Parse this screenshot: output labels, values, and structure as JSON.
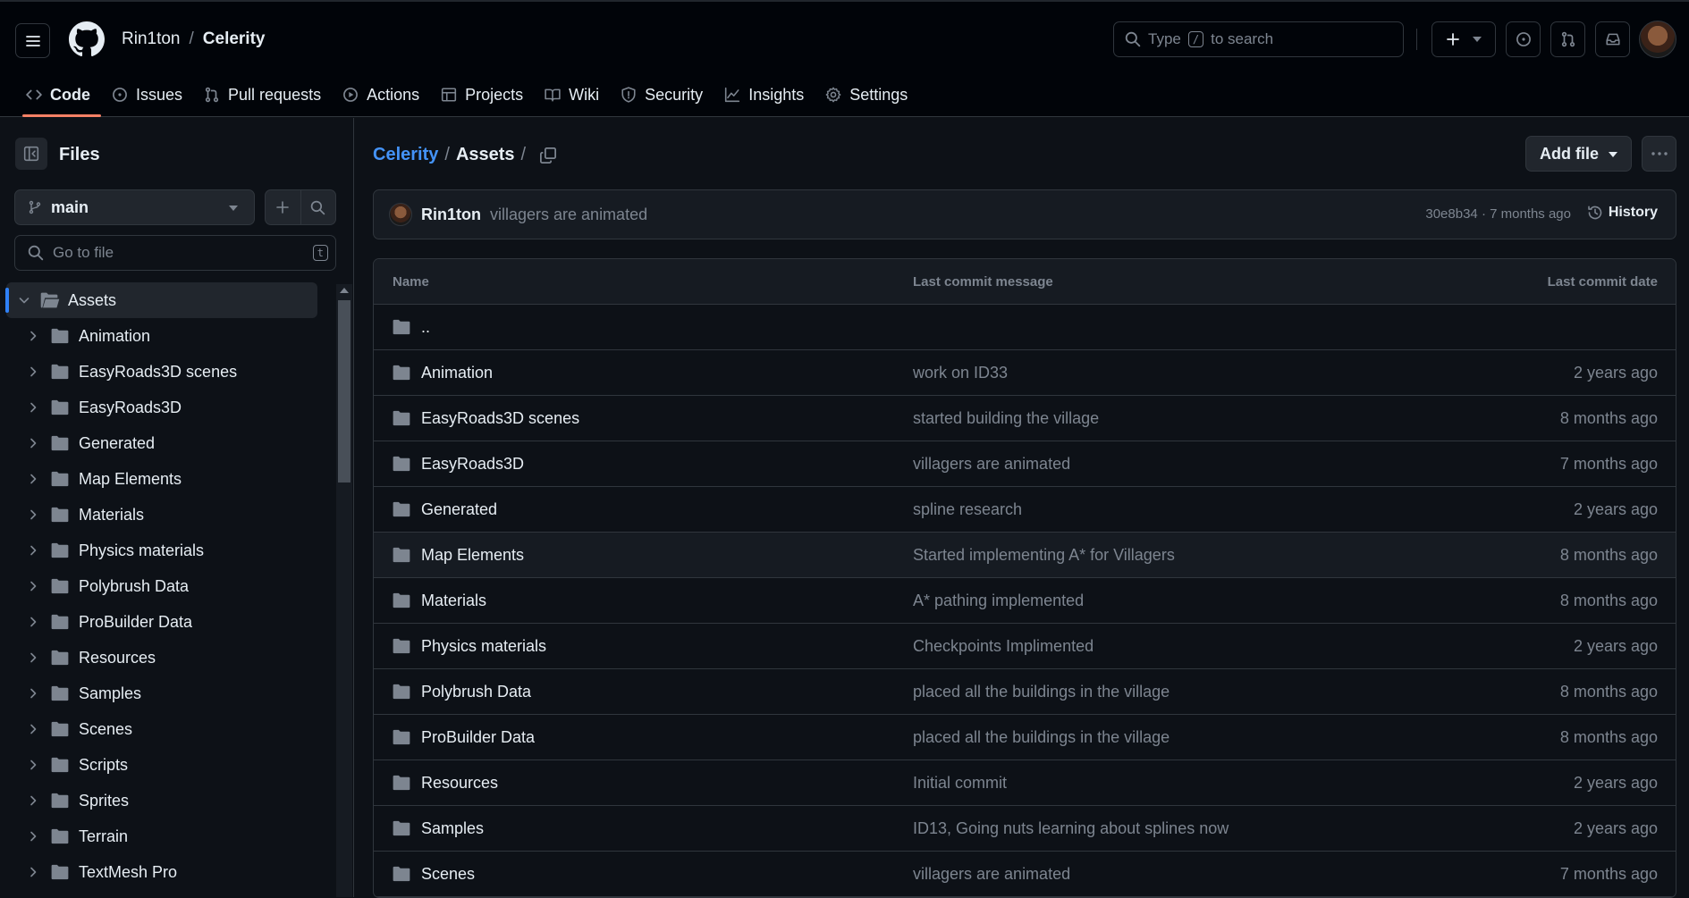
{
  "header": {
    "owner": "Rin1ton",
    "separator": "/",
    "repo": "Celerity",
    "search_prefix": "Type",
    "search_key": "/",
    "search_suffix": "to search"
  },
  "tabs": [
    {
      "label": "Code",
      "icon": "code-icon"
    },
    {
      "label": "Issues",
      "icon": "issue-icon"
    },
    {
      "label": "Pull requests",
      "icon": "pull-request-icon"
    },
    {
      "label": "Actions",
      "icon": "play-icon"
    },
    {
      "label": "Projects",
      "icon": "table-icon"
    },
    {
      "label": "Wiki",
      "icon": "book-icon"
    },
    {
      "label": "Security",
      "icon": "shield-icon"
    },
    {
      "label": "Insights",
      "icon": "graph-icon"
    },
    {
      "label": "Settings",
      "icon": "gear-icon"
    }
  ],
  "sidebar": {
    "title": "Files",
    "branch": "main",
    "goto_placeholder": "Go to file",
    "goto_key": "t",
    "tree": [
      {
        "label": "Assets",
        "root": true
      },
      {
        "label": "Animation"
      },
      {
        "label": "EasyRoads3D scenes"
      },
      {
        "label": "EasyRoads3D"
      },
      {
        "label": "Generated"
      },
      {
        "label": "Map Elements"
      },
      {
        "label": "Materials"
      },
      {
        "label": "Physics materials"
      },
      {
        "label": "Polybrush Data"
      },
      {
        "label": "ProBuilder Data"
      },
      {
        "label": "Resources"
      },
      {
        "label": "Samples"
      },
      {
        "label": "Scenes"
      },
      {
        "label": "Scripts"
      },
      {
        "label": "Sprites"
      },
      {
        "label": "Terrain"
      },
      {
        "label": "TextMesh Pro"
      }
    ]
  },
  "breadcrumb": {
    "repo": "Celerity",
    "sep": "/",
    "folder": "Assets",
    "trail": "/"
  },
  "actions": {
    "add_file": "Add file"
  },
  "commit": {
    "author": "Rin1ton",
    "message": "villagers are animated",
    "meta": "30e8b34 · 7 months ago",
    "history": "History"
  },
  "table": {
    "headers": {
      "name": "Name",
      "message": "Last commit message",
      "date": "Last commit date"
    },
    "rows": [
      {
        "name": "..",
        "message": "",
        "date": ""
      },
      {
        "name": "Animation",
        "message": "work on ID33",
        "date": "2 years ago"
      },
      {
        "name": "EasyRoads3D scenes",
        "message": "started building the village",
        "date": "8 months ago"
      },
      {
        "name": "EasyRoads3D",
        "message": "villagers are animated",
        "date": "7 months ago"
      },
      {
        "name": "Generated",
        "message": "spline research",
        "date": "2 years ago"
      },
      {
        "name": "Map Elements",
        "message": "Started implementing A* for Villagers",
        "date": "8 months ago"
      },
      {
        "name": "Materials",
        "message": "A* pathing implemented",
        "date": "8 months ago"
      },
      {
        "name": "Physics materials",
        "message": "Checkpoints Implimented",
        "date": "2 years ago"
      },
      {
        "name": "Polybrush Data",
        "message": "placed all the buildings in the village",
        "date": "8 months ago"
      },
      {
        "name": "ProBuilder Data",
        "message": "placed all the buildings in the village",
        "date": "8 months ago"
      },
      {
        "name": "Resources",
        "message": "Initial commit",
        "date": "2 years ago"
      },
      {
        "name": "Samples",
        "message": "ID13, Going nuts learning about splines now",
        "date": "2 years ago"
      },
      {
        "name": "Scenes",
        "message": "villagers are animated",
        "date": "7 months ago"
      }
    ]
  }
}
